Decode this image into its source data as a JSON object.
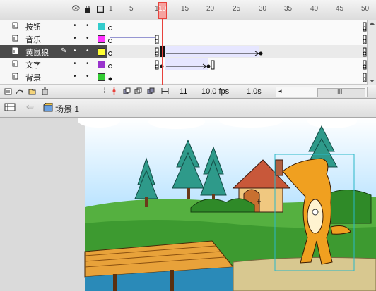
{
  "timeline": {
    "ruler": [
      "1",
      "5",
      "10",
      "15",
      "20",
      "25",
      "30",
      "35",
      "40",
      "45",
      "50"
    ],
    "header_icons": [
      "eye-icon",
      "lock-icon",
      "outline-icon"
    ],
    "layers": [
      {
        "name": "按钮",
        "color": "#33cccc",
        "selected": false
      },
      {
        "name": "音乐",
        "color": "#ff33ff",
        "selected": false
      },
      {
        "name": "黄鼠狼",
        "color": "#ffff33",
        "selected": true
      },
      {
        "name": "文字",
        "color": "#9933cc",
        "selected": false
      },
      {
        "name": "背景",
        "color": "#33cc33",
        "selected": false
      }
    ],
    "current_frame": "11",
    "fps": "10.0 fps",
    "time": "1.0s",
    "scroll_label": "III"
  },
  "scene": {
    "name": "场景 1"
  },
  "colors": {
    "playhead": "#e8423c",
    "selected_layer": "#4a4a4a",
    "tween": "#e6e6ff"
  }
}
